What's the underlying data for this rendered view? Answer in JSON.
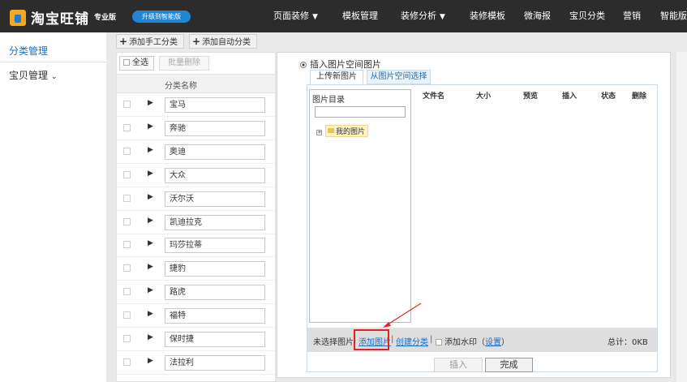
{
  "topbar": {
    "logo_text": "淘宝旺铺",
    "edition": "专业版",
    "upgrade": "升级到智能版",
    "nav": [
      {
        "label": "页面装修",
        "dropdown": true
      },
      {
        "label": "模板管理",
        "dropdown": false
      },
      {
        "label": "装修分析",
        "dropdown": true
      },
      {
        "label": "装修模板",
        "dropdown": false
      },
      {
        "label": "微海报",
        "dropdown": false
      },
      {
        "label": "宝贝分类",
        "dropdown": false
      },
      {
        "label": "营销",
        "dropdown": false
      },
      {
        "label": "智能版",
        "dropdown": false
      }
    ]
  },
  "sidebar": {
    "items": [
      {
        "label": "分类管理",
        "active": true
      },
      {
        "label": "宝贝管理",
        "active": false
      }
    ]
  },
  "toolbar": {
    "add_manual": "添加手工分类",
    "add_auto": "添加自动分类"
  },
  "category_list": {
    "select_all": "全选",
    "batch_delete": "批量删除",
    "header": "分类名称",
    "rows": [
      "宝马",
      "奔驰",
      "奥迪",
      "大众",
      "沃尔沃",
      "凯迪拉克",
      "玛莎拉蒂",
      "捷豹",
      "路虎",
      "福特",
      "保时捷",
      "法拉利"
    ]
  },
  "editor": {
    "radio_label": "插入图片空间图片",
    "tabs": [
      "上传新图片",
      "从图片空间选择"
    ],
    "tree_title": "图片目录",
    "tree_node": "我的图片",
    "file_columns": [
      "文件名",
      "大小",
      "预览",
      "插入",
      "状态",
      "删除"
    ],
    "status": {
      "none_selected": "未选择图片",
      "add_image": "添加图片",
      "create_category": "创建分类",
      "watermark": "添加水印（",
      "settings": "设置",
      "close_paren": "）",
      "total": "总计：0KB"
    },
    "insert_button": "插入",
    "done_button": "完成"
  },
  "colors": {
    "topbar_bg": "#2c2c2c",
    "accent_link": "#1a6fc0",
    "highlight": "#e02424"
  }
}
